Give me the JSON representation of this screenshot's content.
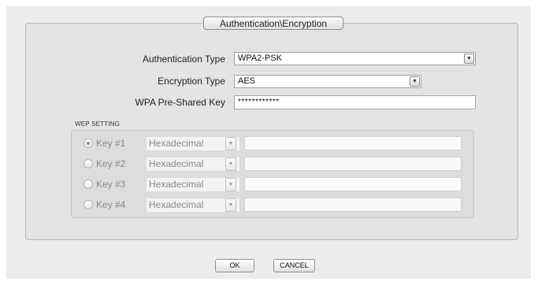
{
  "dialog": {
    "group_title": "Authentication\\Encryption"
  },
  "auth": {
    "auth_type_label": "Authentication Type",
    "auth_type_value": "WPA2-PSK",
    "enc_type_label": "Encryption Type",
    "enc_type_value": "AES",
    "psk_label": "WPA Pre-Shared Key",
    "psk_value": "************"
  },
  "wep": {
    "title": "WEP SETTING",
    "keys": [
      {
        "label": "Key #1",
        "format": "Hexadecimal",
        "selected": true,
        "value": ""
      },
      {
        "label": "Key #2",
        "format": "Hexadecimal",
        "selected": false,
        "value": ""
      },
      {
        "label": "Key #3",
        "format": "Hexadecimal",
        "selected": false,
        "value": ""
      },
      {
        "label": "Key #4",
        "format": "Hexadecimal",
        "selected": false,
        "value": ""
      }
    ]
  },
  "buttons": {
    "ok": "OK",
    "cancel": "CANCEL"
  },
  "icons": {
    "dropdown": "chevron-down-icon"
  },
  "colors": {
    "panel_bg": "#ececec",
    "disabled_text": "#8a8a8a"
  }
}
